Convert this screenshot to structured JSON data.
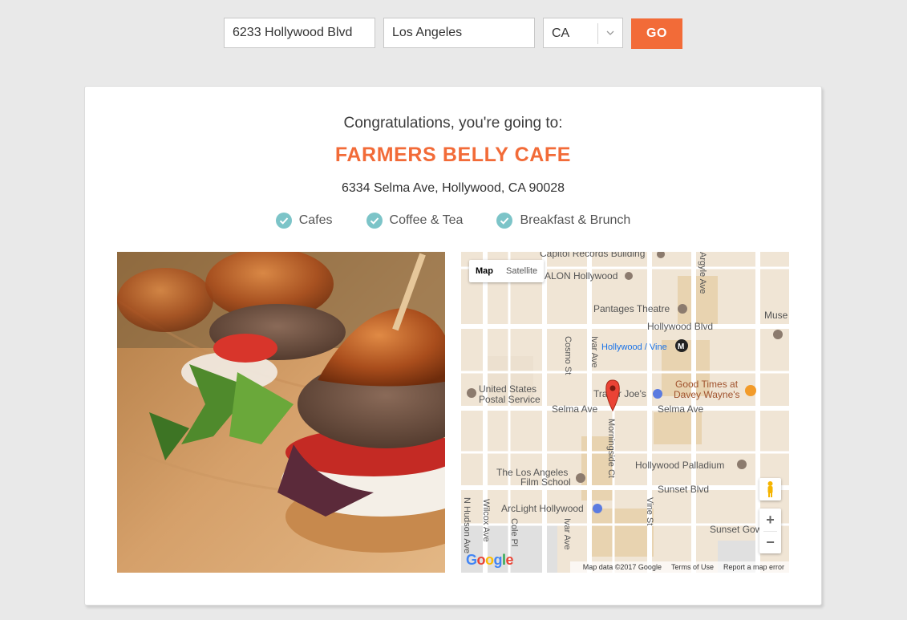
{
  "search": {
    "street_value": "6233 Hollywood Blvd",
    "city_value": "Los Angeles",
    "state_value": "CA",
    "go_label": "GO"
  },
  "result": {
    "intro": "Congratulations, you're going to:",
    "name": "FARMERS BELLY CAFE",
    "address": "6334 Selma Ave, Hollywood, CA 90028",
    "categories": [
      "Cafes",
      "Coffee & Tea",
      "Breakfast & Brunch"
    ]
  },
  "map": {
    "type_controls": {
      "map": "Map",
      "satellite": "Satellite"
    },
    "labels": {
      "capitol": "Capitol Records Building",
      "avalon": "ALON Hollywood",
      "pantages": "Pantages Theatre",
      "museum": "Muse",
      "hollywood_blvd": "Hollywood Blvd",
      "hollywood_vine": "Hollywood / Vine",
      "cosmo": "Cosmo St",
      "ivar_top": "Ivar Ave",
      "argyle": "Argyle Ave",
      "usps1": "United States",
      "usps2": "Postal Service",
      "trader": "Trader Joe's",
      "good1": "Good Times at",
      "good2": "Davey Wayne's",
      "selma_left": "Selma Ave",
      "selma_right": "Selma Ave",
      "morningside": "Morningside Ct",
      "palladium": "Hollywood Palladium",
      "film1": "The Los Angeles",
      "film2": "Film School",
      "sunset": "Sunset Blvd",
      "arclight": "ArcLight Hollywood",
      "vine_st": "Vine St",
      "sunset_gower": "Sunset Gow",
      "n_hudson": "N Hudson Ave",
      "wilcox": "Wilcox Ave",
      "cole": "Cole Pl",
      "ivar_bottom": "Ivar Ave"
    },
    "google": "Google",
    "footer": {
      "data": "Map data ©2017 Google",
      "terms": "Terms of Use",
      "report": "Report a map error"
    }
  },
  "colors": {
    "accent": "#f26b38",
    "check": "#7cc4c8",
    "pin": "#ea4335"
  }
}
